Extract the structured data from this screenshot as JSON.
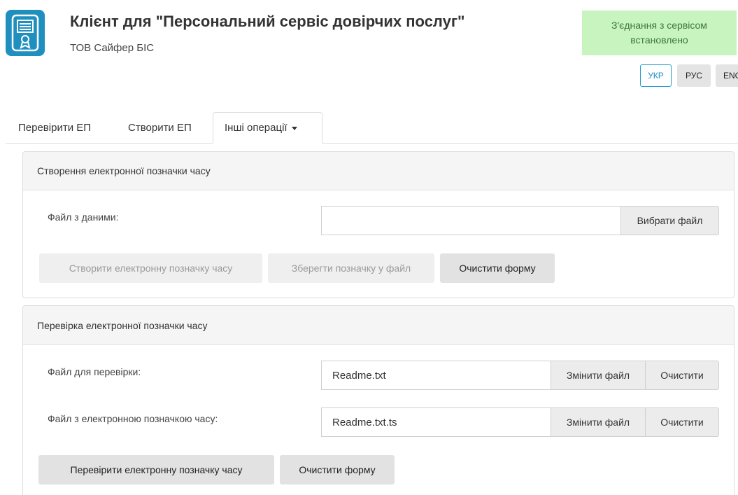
{
  "header": {
    "title": "Клієнт для \"Персональний сервіс довірчих послуг\"",
    "organization": "ТОВ Сайфер БІС",
    "status": "З'єднання з сервісом встановлено"
  },
  "languages": [
    {
      "label": "УКР",
      "active": true
    },
    {
      "label": "РУС",
      "active": false
    },
    {
      "label": "ENG",
      "active": false
    }
  ],
  "tabs": [
    {
      "label": "Перевірити ЕП"
    },
    {
      "label": "Створити ЕП"
    },
    {
      "label": "Інші операції",
      "active": true
    }
  ],
  "create_panel": {
    "title": "Створення електронної позначки часу",
    "file_label": "Файл з даними:",
    "file_value": "",
    "choose_button": "Вибрати файл",
    "create_button": "Створити електронну позначку часу",
    "save_button": "Зберегти позначку у файл",
    "clear_form_button": "Очистити форму"
  },
  "verify_panel": {
    "title": "Перевірка електронної позначки часу",
    "file_label": "Файл для перевірки:",
    "file_value": "Readme.txt",
    "ts_label": "Файл з електронною позначкою часу:",
    "ts_value": "Readme.txt.ts",
    "change_button": "Змінити файл",
    "clear_button": "Очистити",
    "verify_button": "Перевірити електронну позначку часу",
    "clear_form_button": "Очистити форму"
  },
  "colors": {
    "status_bg": "#c8f4c0",
    "status_text": "#3c763d",
    "accent": "#1f8fbf"
  }
}
